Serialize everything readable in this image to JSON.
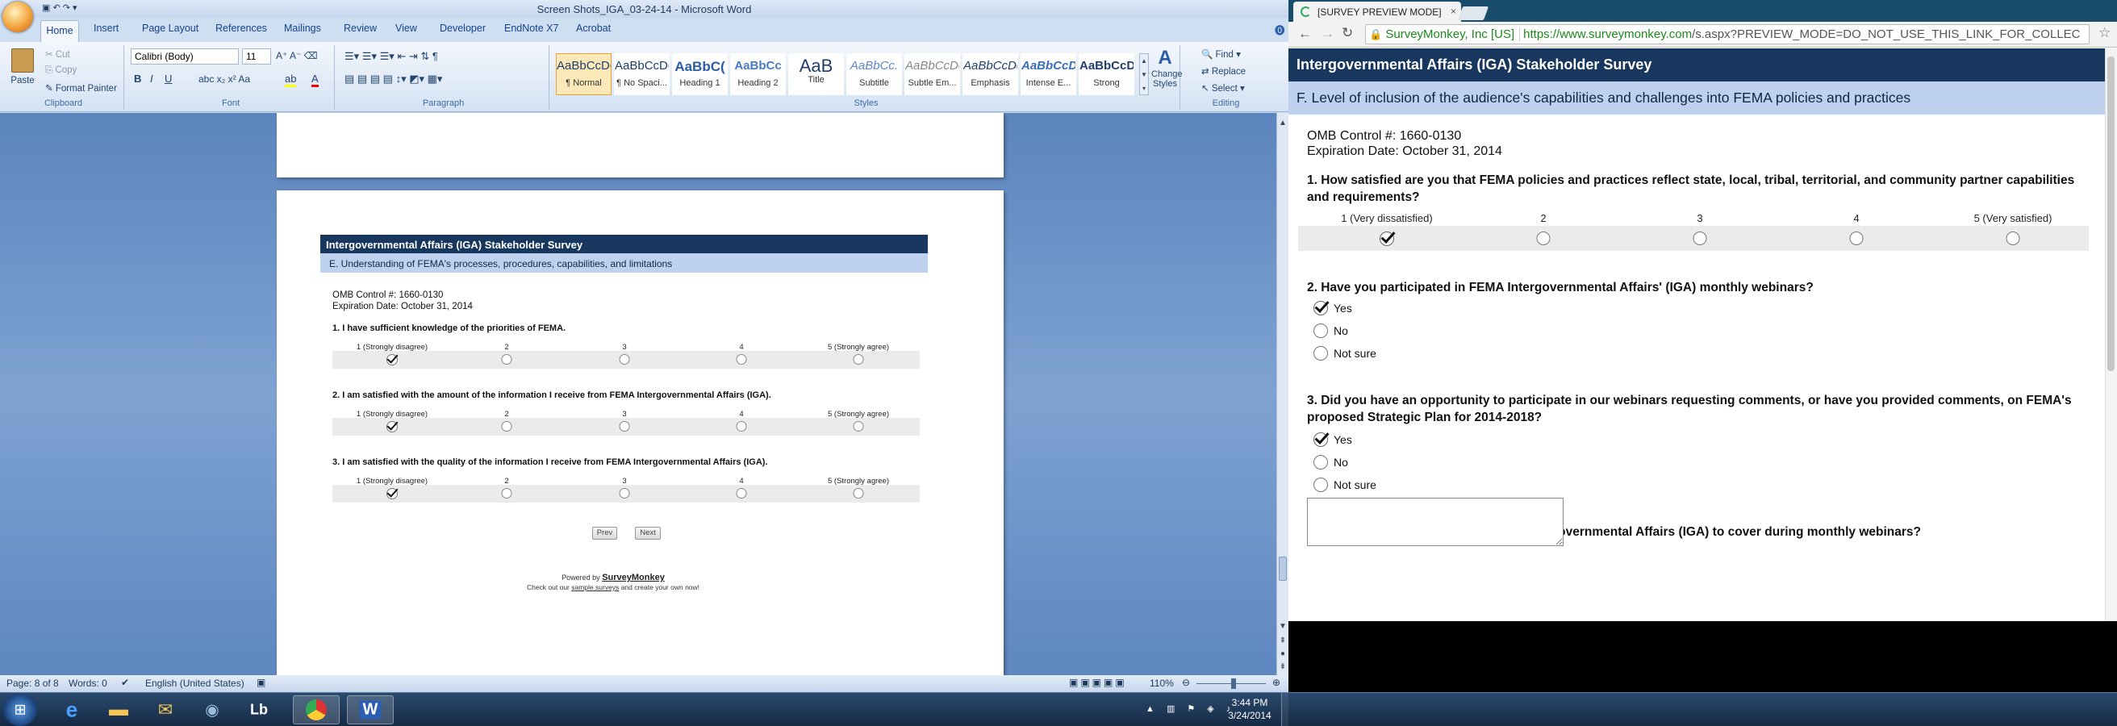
{
  "word": {
    "title": "Screen Shots_IGA_03-24-14 - Microsoft Word",
    "tabs": [
      "Home",
      "Insert",
      "Page Layout",
      "References",
      "Mailings",
      "Review",
      "View",
      "Developer",
      "EndNote X7",
      "Acrobat"
    ],
    "clipboard": {
      "paste": "Paste",
      "cut": "Cut",
      "copy": "Copy",
      "format_painter": "Format Painter",
      "label": "Clipboard"
    },
    "font": {
      "name": "Calibri (Body)",
      "size": "11",
      "label": "Font"
    },
    "paragraph_label": "Paragraph",
    "styles": [
      {
        "preview": "AaBbCcDc",
        "name": "¶ Normal"
      },
      {
        "preview": "AaBbCcDc",
        "name": "¶ No Spaci..."
      },
      {
        "preview": "AaBbC(",
        "name": "Heading 1"
      },
      {
        "preview": "AaBbCc",
        "name": "Heading 2"
      },
      {
        "preview": "AaB",
        "name": "Title"
      },
      {
        "preview": "AaBbCc.",
        "name": "Subtitle"
      },
      {
        "preview": "AaBbCcDc",
        "name": "Subtle Em..."
      },
      {
        "preview": "AaBbCcDc",
        "name": "Emphasis"
      },
      {
        "preview": "AaBbCcDc",
        "name": "Intense E..."
      },
      {
        "preview": "AaBbCcDc",
        "name": "Strong"
      }
    ],
    "styles_label": "Styles",
    "change_styles": "Change Styles",
    "editing": {
      "find": "Find",
      "replace": "Replace",
      "select": "Select",
      "label": "Editing"
    },
    "status": {
      "page": "Page: 8 of 8",
      "words": "Words: 0",
      "language": "English (United States)",
      "zoom": "110%"
    },
    "survey": {
      "title": "Intergovernmental Affairs (IGA) Stakeholder Survey",
      "section": "E. Understanding of FEMA's processes, procedures, capabilities, and limitations",
      "omb": "OMB Control #: 1660-0130",
      "expiration": "Expiration Date: October 31, 2014",
      "scale": [
        "1 (Strongly disagree)",
        "2",
        "3",
        "4",
        "5 (Strongly agree)"
      ],
      "questions": [
        {
          "text": "1. I have sufficient knowledge of the priorities of FEMA.",
          "selected": 1
        },
        {
          "text": "2. I am satisfied with the amount of the information I receive from FEMA Intergovernmental Affairs (IGA).",
          "selected": 1
        },
        {
          "text": "3. I am satisfied with the quality of the information I receive from FEMA Intergovernmental Affairs (IGA).",
          "selected": 1
        }
      ],
      "prev": "Prev",
      "next": "Next",
      "powered_by": "Powered by",
      "brand": "SurveyMonkey",
      "footer_pre": "Check out our",
      "footer_link": "sample surveys",
      "footer_post": "and create your own now!"
    }
  },
  "chrome": {
    "tab_title": "[SURVEY PREVIEW MODE]",
    "ev_cert": "SurveyMonkey, Inc [US]",
    "url_host": "https://www.surveymonkey.com",
    "url_path": "/s.aspx?PREVIEW_MODE=DO_NOT_USE_THIS_LINK_FOR_COLLEC",
    "survey": {
      "title": "Intergovernmental Affairs (IGA) Stakeholder Survey",
      "section": "F. Level of inclusion of the audience's capabilities and challenges into FEMA policies and practices",
      "omb": "OMB Control #: 1660-0130",
      "expiration": "Expiration Date: October 31, 2014",
      "q1": "1. How satisfied are you that FEMA policies and practices reflect state, local, tribal, territorial, and community partner capabilities and requirements?",
      "q1_scale": [
        "1 (Very dissatisfied)",
        "2",
        "3",
        "4",
        "5 (Very satisfied)"
      ],
      "q1_selected": 1,
      "q2": "2. Have you participated in FEMA Intergovernmental Affairs' (IGA) monthly webinars?",
      "q2_options": [
        "Yes",
        "No",
        "Not sure"
      ],
      "q2_selected": "Yes",
      "q3": "3. Did you have an opportunity to participate in our webinars requesting comments, or have you provided comments, on FEMA's proposed Strategic Plan for 2014-2018?",
      "q3_options": [
        "Yes",
        "No",
        "Not sure"
      ],
      "q3_selected": "Yes",
      "q4": "4. What topics would you like FEMA Intergovernmental Affairs (IGA) to cover during monthly webinars?"
    }
  },
  "taskbar": {
    "time": "3:44 PM",
    "date": "3/24/2014"
  },
  "colors": {
    "survey_header": "#17375e",
    "survey_section": "#bed1ef",
    "word_body": "#6a91c8",
    "taskbar": "#1f3a5e"
  }
}
